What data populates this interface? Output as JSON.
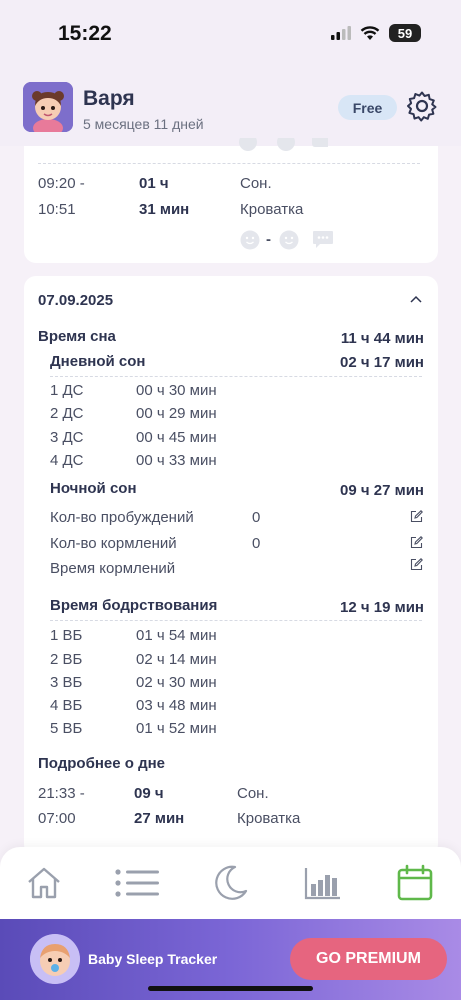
{
  "status": {
    "time": "15:22",
    "battery": "59"
  },
  "header": {
    "name": "Варя",
    "age": "5 месяцев 11 дней",
    "badge": "Free"
  },
  "prev_entry": {
    "time_start": "09:20 -",
    "time_end": "10:51",
    "dur_h": "01 ч",
    "dur_m": "31 мин",
    "type": "Сон.",
    "place": "Кроватка",
    "mood_sep": "-"
  },
  "day": {
    "date": "07.09.2025",
    "sleep_label": "Время сна",
    "sleep_total": "11 ч 44 мин",
    "day_sleep_label": "Дневной сон",
    "day_sleep_total": "02 ч 17 мин",
    "naps": [
      {
        "label": "1 ДС",
        "value": "00 ч 30 мин"
      },
      {
        "label": "2 ДС",
        "value": "00 ч 29 мин"
      },
      {
        "label": "3 ДС",
        "value": "00 ч 45 мин"
      },
      {
        "label": "4 ДС",
        "value": "00 ч 33 мин"
      }
    ],
    "night_label": "Ночной сон",
    "night_total": "09 ч 27 мин",
    "wakeups_label": "Кол-во пробуждений",
    "wakeups_value": "0",
    "feedings_label": "Кол-во кормлений",
    "feedings_value": "0",
    "feed_time_label": "Время кормлений",
    "awake_label": "Время бодрствования",
    "awake_total": "12 ч 19 мин",
    "awake": [
      {
        "label": "1 ВБ",
        "value": "01 ч 54 мин"
      },
      {
        "label": "2 ВБ",
        "value": "02 ч 14 мин"
      },
      {
        "label": "3 ВБ",
        "value": "02 ч 30 мин"
      },
      {
        "label": "4 ВБ",
        "value": "03 ч 48 мин"
      },
      {
        "label": "5 ВБ",
        "value": "01 ч 52 мин"
      }
    ],
    "details_label": "Подробнее о дне",
    "entry": {
      "time_start": "21:33 -",
      "time_end": "07:00",
      "dur_h": "09 ч",
      "dur_m": "27 мин",
      "type": "Сон.",
      "place": "Кроватка"
    }
  },
  "nav": [
    "home-icon",
    "list-icon",
    "moon-icon",
    "stats-icon",
    "calendar-icon"
  ],
  "promo": {
    "title": "Baby Sleep Tracker",
    "button": "GO PREMIUM"
  },
  "colors": {
    "accent": "#6b4fd0",
    "nav_active": "#5fb84a",
    "premium": "#e6657f"
  }
}
